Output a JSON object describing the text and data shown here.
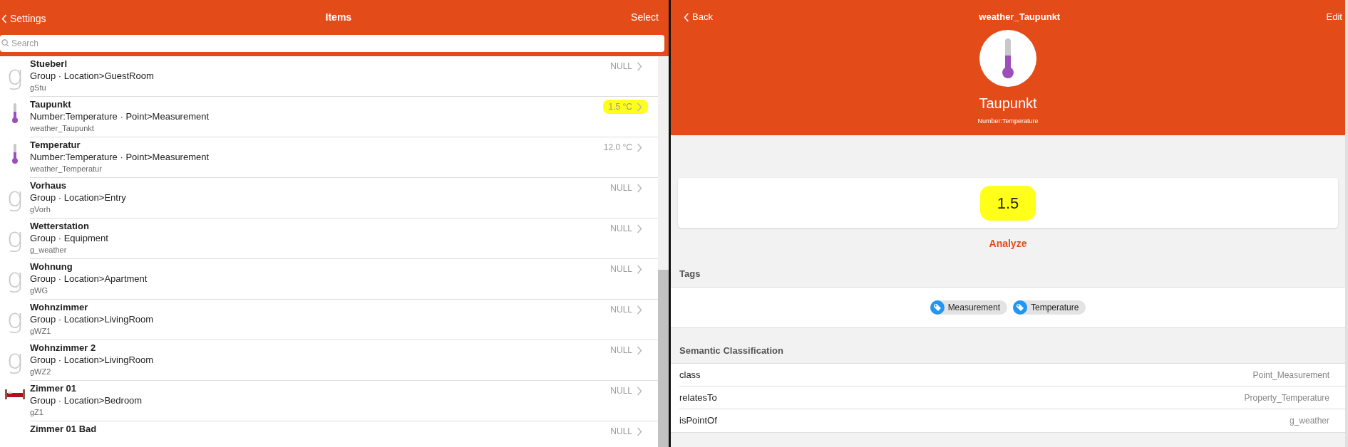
{
  "items_panel": {
    "back": "Settings",
    "title": "Items",
    "action": "Select",
    "search": {
      "placeholder": "Search"
    },
    "items": [
      {
        "kind": "group",
        "glyph": "g",
        "name": "Stueberl",
        "type": "Group · Location>GuestRoom",
        "id": "gStu",
        "value": "NULL",
        "highlighted": false
      },
      {
        "kind": "thermometer",
        "name": "Taupunkt",
        "type": "Number:Temperature · Point>Measurement",
        "id": "weather_Taupunkt",
        "value": "1.5 °C",
        "highlighted": true
      },
      {
        "kind": "thermometer",
        "name": "Temperatur",
        "type": "Number:Temperature · Point>Measurement",
        "id": "weather_Temperatur",
        "value": "12.0 °C",
        "highlighted": false
      },
      {
        "kind": "group",
        "glyph": "g",
        "name": "Vorhaus",
        "type": "Group · Location>Entry",
        "id": "gVorh",
        "value": "NULL",
        "highlighted": false
      },
      {
        "kind": "group",
        "glyph": "g",
        "name": "Wetterstation",
        "type": "Group · Equipment",
        "id": "g_weather",
        "value": "NULL",
        "highlighted": false
      },
      {
        "kind": "group",
        "glyph": "g",
        "name": "Wohnung",
        "type": "Group · Location>Apartment",
        "id": "gWG",
        "value": "NULL",
        "highlighted": false
      },
      {
        "kind": "group",
        "glyph": "g",
        "name": "Wohnzimmer",
        "type": "Group · Location>LivingRoom",
        "id": "gWZ1",
        "value": "NULL",
        "highlighted": false
      },
      {
        "kind": "group",
        "glyph": "g",
        "name": "Wohnzimmer 2",
        "type": "Group · Location>LivingRoom",
        "id": "gWZ2",
        "value": "NULL",
        "highlighted": false
      },
      {
        "kind": "bed",
        "name": "Zimmer 01",
        "type": "Group · Location>Bedroom",
        "id": "gZ1",
        "value": "NULL",
        "highlighted": false
      },
      {
        "kind": "plain",
        "name": "Zimmer 01 Bad",
        "value": "NULL",
        "highlighted": false
      }
    ]
  },
  "detail_panel": {
    "back": "Back",
    "title": "weather_Taupunkt",
    "action": "Edit",
    "name": "Taupunkt",
    "type": "Number:Temperature",
    "state": {
      "value": "1.5",
      "highlighted": true
    },
    "analyze": "Analyze",
    "tags": {
      "heading": "Tags",
      "items": [
        "Measurement",
        "Temperature"
      ]
    },
    "semantic": {
      "heading": "Semantic Classification",
      "rows": [
        {
          "key": "class",
          "value": "Point_Measurement"
        },
        {
          "key": "relatesTo",
          "value": "Property_Temperature"
        },
        {
          "key": "isPointOf",
          "value": "g_weather"
        }
      ]
    }
  }
}
